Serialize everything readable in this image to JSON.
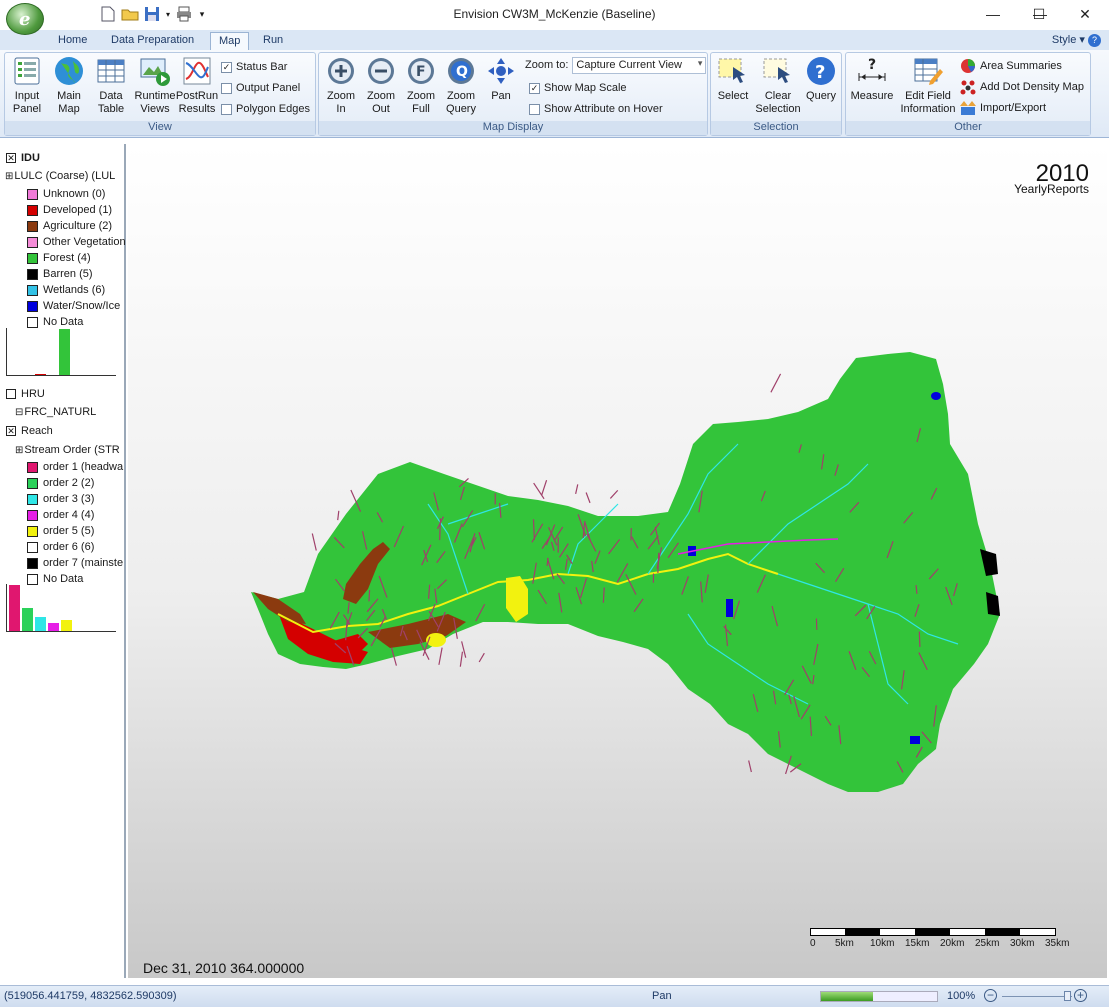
{
  "window": {
    "title": "Envision CW3M_McKenzie (Baseline)",
    "minimize_glyph": "—",
    "maximize_glyph": "☐",
    "close_glyph": "✕"
  },
  "app_orb": {
    "letter": "e"
  },
  "ribbon_tabs": [
    {
      "label": "Home",
      "active": false
    },
    {
      "label": "Data Preparation",
      "active": false
    },
    {
      "label": "Map",
      "active": true
    },
    {
      "label": "Run",
      "active": false
    }
  ],
  "style_menu": "Style ▾",
  "view_group": {
    "label": "View",
    "buttons": [
      {
        "label": "Input Panel",
        "icon": "input-panel-icon"
      },
      {
        "label": "Main Map",
        "icon": "globe-icon"
      },
      {
        "label": "Data Table",
        "icon": "table-icon"
      },
      {
        "label": "Runtime Views",
        "icon": "runtime-views-icon"
      },
      {
        "label": "PostRun Results",
        "icon": "postrun-chart-icon"
      }
    ],
    "checks": [
      {
        "label": "Status Bar",
        "checked": true
      },
      {
        "label": "Output Panel",
        "checked": false
      },
      {
        "label": "Polygon Edges",
        "checked": false
      }
    ]
  },
  "map_display_group": {
    "label": "Map Display",
    "buttons": [
      {
        "label": "Zoom In",
        "icon": "zoom-in-icon"
      },
      {
        "label": "Zoom Out",
        "icon": "zoom-out-icon"
      },
      {
        "label": "Zoom Full",
        "icon": "zoom-full-icon"
      },
      {
        "label": "Zoom Query",
        "icon": "zoom-query-icon"
      },
      {
        "label": "Pan",
        "icon": "pan-icon"
      }
    ],
    "zoom_to_label": "Zoom to:",
    "zoom_to_value": "Capture Current View",
    "checks": [
      {
        "label": "Show Map Scale",
        "checked": true
      },
      {
        "label": "Show Attribute on Hover",
        "checked": false
      }
    ]
  },
  "selection_group": {
    "label": "Selection",
    "buttons": [
      {
        "label": "Select",
        "icon": "select-icon"
      },
      {
        "label": "Clear Selection",
        "icon": "clear-selection-icon"
      },
      {
        "label": "Query",
        "icon": "query-icon"
      }
    ]
  },
  "other_group": {
    "label": "Other",
    "buttons": [
      {
        "label": "Measure",
        "icon": "measure-icon"
      },
      {
        "label": "Edit Field Information",
        "icon": "edit-field-icon"
      }
    ],
    "small_buttons": [
      {
        "label": "Area Summaries",
        "icon": "area-summaries-icon"
      },
      {
        "label": "Add Dot Density Map",
        "icon": "dot-density-icon"
      },
      {
        "label": "Import/Export",
        "icon": "import-export-icon"
      }
    ]
  },
  "layers": {
    "idu": {
      "name": "IDU",
      "checked": true,
      "field": "LULC (Coarse) (LUL",
      "legend": [
        {
          "label": "Unknown (0)",
          "color": "#f07ad8"
        },
        {
          "label": "Developed (1)",
          "color": "#d40000"
        },
        {
          "label": "Agriculture (2)",
          "color": "#8b3a0f"
        },
        {
          "label": "Other Vegetation",
          "color": "#f58cd8"
        },
        {
          "label": "Forest (4)",
          "color": "#33c43a"
        },
        {
          "label": "Barren (5)",
          "color": "#000000"
        },
        {
          "label": "Wetlands (6)",
          "color": "#33c2e6"
        },
        {
          "label": "Water/Snow/Ice",
          "color": "#0000dd"
        },
        {
          "label": "No Data",
          "color": "#ffffff"
        }
      ],
      "histogram": [
        {
          "color": "#d40000",
          "value": 2
        },
        {
          "color": "#33c43a",
          "value": 100
        }
      ]
    },
    "hru": {
      "name": "HRU",
      "checked": false,
      "field": "FRC_NATURL"
    },
    "reach": {
      "name": "Reach",
      "checked": true,
      "field": "Stream Order (STR",
      "legend": [
        {
          "label": "order 1 (headwa",
          "color": "#e0176f"
        },
        {
          "label": "order 2 (2)",
          "color": "#2bd15a"
        },
        {
          "label": "order 3 (3)",
          "color": "#2fe6e6"
        },
        {
          "label": "order 4 (4)",
          "color": "#e61ee6"
        },
        {
          "label": "order 5 (5)",
          "color": "#f2f20f"
        },
        {
          "label": "order 6 (6)",
          "color": "#ffffff"
        },
        {
          "label": "order 7 (mainste",
          "color": "#000000"
        },
        {
          "label": "No Data",
          "color": "#ffffff"
        }
      ],
      "histogram": [
        {
          "color": "#e0176f",
          "value": 100
        },
        {
          "color": "#2bd15a",
          "value": 50
        },
        {
          "color": "#2fe6e6",
          "value": 30
        },
        {
          "color": "#e61ee6",
          "value": 17
        },
        {
          "color": "#f2f20f",
          "value": 24
        }
      ]
    }
  },
  "map": {
    "year": "2010",
    "subtitle": "YearlyReports",
    "date": "Dec 31, 2010 364.000000",
    "scale_labels": [
      "0",
      "5km",
      "10km",
      "15km",
      "20km",
      "25km",
      "30km",
      "35km"
    ],
    "colors": {
      "forest": "#33c43a",
      "stream": "#a0406a",
      "river": "#f2f20f",
      "tributary": "#2fe6e6"
    }
  },
  "statusbar": {
    "coords": "(519056.441759, 4832562.590309)",
    "mode": "Pan",
    "progress": 0.45,
    "zoom": "100%"
  }
}
